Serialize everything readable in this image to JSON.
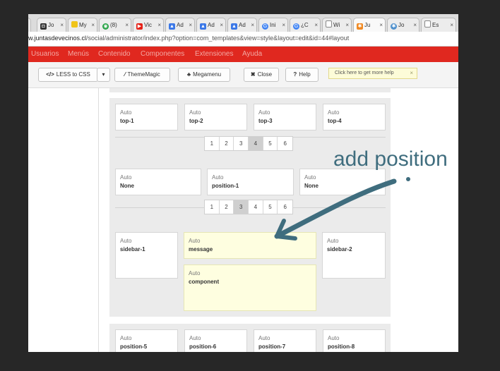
{
  "tabs": [
    {
      "label": "Jo",
      "icon": "github-icon",
      "color": "#333333",
      "active": false
    },
    {
      "label": "My",
      "icon": "rainbow-icon",
      "color": "#e6b800",
      "active": false
    },
    {
      "label": "(8)",
      "icon": "whatsapp-icon",
      "color": "#25a244",
      "active": false
    },
    {
      "label": "Vic",
      "icon": "youtube-icon",
      "color": "#e62117",
      "active": false
    },
    {
      "label": "Ad",
      "icon": "adwords-icon",
      "color": "#3b78e7",
      "active": false
    },
    {
      "label": "Ad",
      "icon": "adwords-icon",
      "color": "#3b78e7",
      "active": false
    },
    {
      "label": "Ad",
      "icon": "adwords-icon",
      "color": "#3b78e7",
      "active": false
    },
    {
      "label": "Ini",
      "icon": "google-icon",
      "color": "#4285f4",
      "active": false
    },
    {
      "label": "¿C",
      "icon": "google-icon",
      "color": "#4285f4",
      "active": false
    },
    {
      "label": "Wi",
      "icon": "page-icon",
      "color": "#888888",
      "active": false
    },
    {
      "label": "Ju",
      "icon": "joomla-icon",
      "color": "#f08a24",
      "active": true
    },
    {
      "label": "Jo",
      "icon": "joomla-icon",
      "color": "#5091cd",
      "active": false
    },
    {
      "label": "Es",
      "icon": "page-icon",
      "color": "#888888",
      "active": false
    }
  ],
  "url": {
    "host": "w.juntasdevecinos.cl",
    "path": "/social/administrator/index.php?option=com_templates&view=style&layout=edit&id=44#layout"
  },
  "menu": [
    "Usuarios",
    "Menús",
    "Contenido",
    "Componentes",
    "Extensiones",
    "Ayuda"
  ],
  "toolbar": {
    "less_to_css": "LESS to CSS",
    "less_icon": "</>",
    "dropdown_caret": "▾",
    "thememagic": "ThemeMagic",
    "megamenu": "Megamenu",
    "close": "Close",
    "help": "Help",
    "help_tip": "Click here to get more help",
    "help_tip_close": "×"
  },
  "layout": {
    "row1": [
      {
        "type": "Auto",
        "name": "top-1"
      },
      {
        "type": "Auto",
        "name": "top-2"
      },
      {
        "type": "Auto",
        "name": "top-3"
      },
      {
        "type": "Auto",
        "name": "top-4"
      }
    ],
    "pager1": {
      "pages": [
        "1",
        "2",
        "3",
        "4",
        "5",
        "6"
      ],
      "selected": "4"
    },
    "row2": [
      {
        "type": "Auto",
        "name": "None"
      },
      {
        "type": "Auto",
        "name": "position-1"
      },
      {
        "type": "Auto",
        "name": "None"
      }
    ],
    "pager2": {
      "pages": [
        "1",
        "2",
        "3",
        "4",
        "5",
        "6"
      ],
      "selected": "3"
    },
    "row3": {
      "left": {
        "type": "Auto",
        "name": "sidebar-1"
      },
      "message": {
        "type": "Auto",
        "name": "message"
      },
      "component": {
        "type": "Auto",
        "name": "component"
      },
      "right": {
        "type": "Auto",
        "name": "sidebar-2"
      }
    },
    "row4": [
      {
        "type": "Auto",
        "name": "position-5"
      },
      {
        "type": "Auto",
        "name": "position-6"
      },
      {
        "type": "Auto",
        "name": "position-7"
      },
      {
        "type": "Auto",
        "name": "position-8"
      }
    ]
  },
  "annotation": {
    "text": "add position",
    "color": "#3f6d7e"
  }
}
